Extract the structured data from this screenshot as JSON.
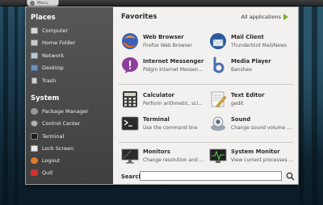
{
  "panel": {
    "menu_label": "Menu"
  },
  "sidebar": {
    "places_title": "Places",
    "places": [
      {
        "label": "Computer",
        "icon": "computer-icon"
      },
      {
        "label": "Home Folder",
        "icon": "home-folder-icon"
      },
      {
        "label": "Network",
        "icon": "network-icon"
      },
      {
        "label": "Desktop",
        "icon": "desktop-icon"
      },
      {
        "label": "Trash",
        "icon": "trash-icon"
      }
    ],
    "system_title": "System",
    "system": [
      {
        "label": "Package Manager",
        "icon": "package-manager-icon"
      },
      {
        "label": "Control Center",
        "icon": "control-center-icon"
      },
      {
        "label": "Terminal",
        "icon": "terminal-icon"
      },
      {
        "label": "Lock Screen",
        "icon": "lock-screen-icon"
      },
      {
        "label": "Logout",
        "icon": "logout-icon"
      },
      {
        "label": "Quit",
        "icon": "quit-icon"
      }
    ]
  },
  "main": {
    "favorites_title": "Favorites",
    "all_applications": "All applications",
    "apps": [
      {
        "name": "Web Browser",
        "desc": "Firefox Web Browser",
        "icon": "firefox-icon"
      },
      {
        "name": "Mail Client",
        "desc": "Thunderbird Mail/News",
        "icon": "thunderbird-icon"
      },
      {
        "name": "Internet Messenger",
        "desc": "Pidgin Internet Messen...",
        "icon": "pidgin-icon"
      },
      {
        "name": "Media Player",
        "desc": "Banshee",
        "icon": "banshee-icon"
      },
      {
        "name": "Calculator",
        "desc": "Perform arithmetic, sci...",
        "icon": "calculator-icon"
      },
      {
        "name": "Text Editor",
        "desc": "gedit",
        "icon": "text-editor-icon"
      },
      {
        "name": "Terminal",
        "desc": "Use the command line",
        "icon": "terminal-icon"
      },
      {
        "name": "Sound",
        "desc": "Change sound volume ...",
        "icon": "sound-icon"
      },
      {
        "name": "Monitors",
        "desc": "Change resolution and ...",
        "icon": "monitors-icon"
      },
      {
        "name": "System Monitor",
        "desc": "View current processes ...",
        "icon": "system-monitor-icon"
      }
    ]
  },
  "search": {
    "label": "Search:",
    "value": "",
    "placeholder": ""
  }
}
